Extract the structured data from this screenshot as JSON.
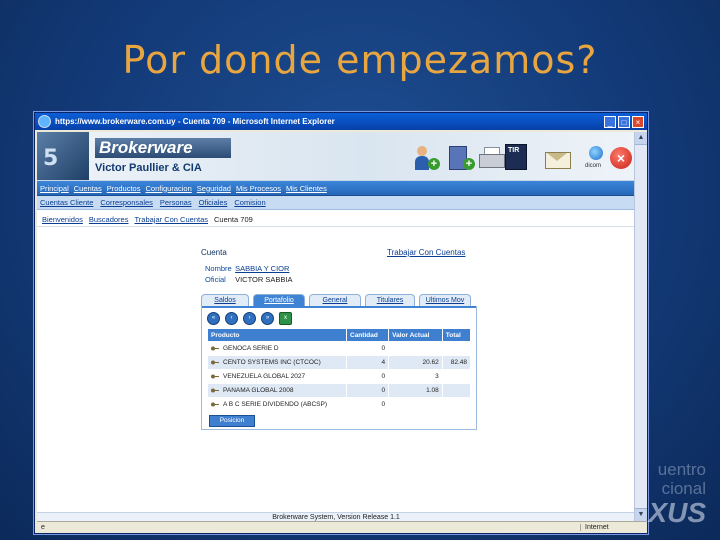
{
  "slide": {
    "title": "Por donde empezamos?",
    "brand_line1": "uentro",
    "brand_line2": "cional",
    "brand_line3": "XUS"
  },
  "browser": {
    "title": "https://www.brokerware.com.uy - Cuenta 709 - Microsoft Internet Explorer",
    "status_zone": "Internet"
  },
  "app": {
    "brand": "Brokerware",
    "company": "Victor Paullier & CIA",
    "icons": [
      "add-user-icon",
      "add-book-icon",
      "printer-icon",
      "tir-calculator-icon",
      "mail-icon",
      "globe-icon",
      "exit-icon"
    ],
    "tir_label": "TIR",
    "globe_label": "dicom"
  },
  "menu_main": [
    "Principal",
    "Cuentas",
    "Productos",
    "Configuracion",
    "Seguridad",
    "Mis Procesos",
    "Mis Clientes"
  ],
  "menu_sub": [
    "Cuentas Cliente",
    "Corresponsales",
    "Personas",
    "Oficiales",
    "Comision"
  ],
  "breadcrumb": {
    "items": [
      "Bienvenidos",
      "Buscadores",
      "Trabajar Con Cuentas"
    ],
    "current": "Cuenta 709"
  },
  "account": {
    "section_title": "Cuenta",
    "action_link": "Trabajar Con Cuentas",
    "name_label": "Nombre",
    "name_value": "SABBIA Y CIOR",
    "officer_label": "Oficial",
    "officer_value": "VICTOR SABBIA"
  },
  "tabs": [
    "Saldos",
    "Portafolio",
    "General",
    "Titulares",
    "Ultimos Mov"
  ],
  "active_tab": "Portafolio",
  "table": {
    "headers": [
      "Producto",
      "Cantidad",
      "Valor Actual",
      "Total"
    ],
    "rows": [
      [
        "GENOCA SERIE D",
        "0",
        "",
        ""
      ],
      [
        "CENTO SYSTEMS INC (CTCOC)",
        "4",
        "20.62",
        "82.48"
      ],
      [
        "VENEZUELA GLOBAL 2027",
        "0",
        "3",
        ""
      ],
      [
        "PANAMA GLOBAL 2008",
        "0",
        "1.08",
        ""
      ],
      [
        "A B C SERIE DIVIDENDO (ABCSP)",
        "0",
        "",
        ""
      ]
    ]
  },
  "buttons": {
    "action": "Posicion"
  },
  "footer": "Brokerware System, Version Release 1.1"
}
